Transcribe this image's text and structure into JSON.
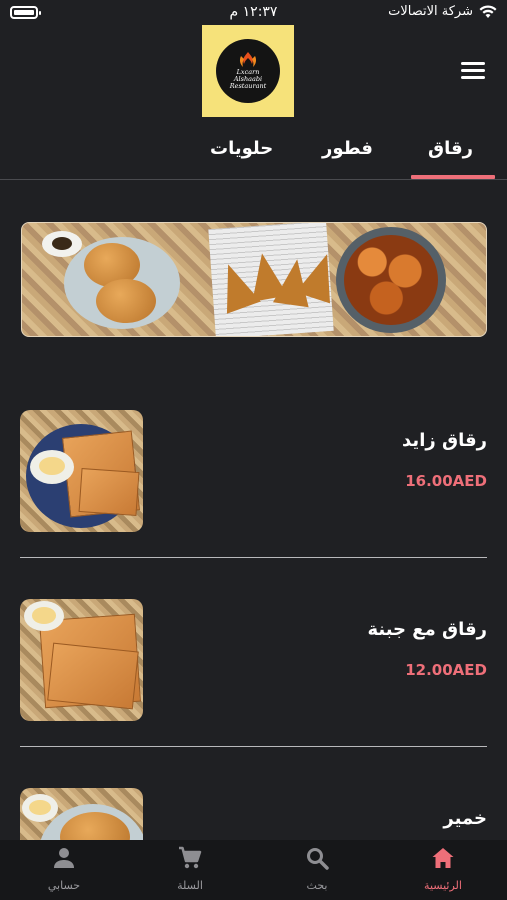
{
  "status_bar": {
    "time": "١٢:٣٧ م",
    "carrier": "شركة الاتصالات"
  },
  "header": {
    "logo_text": [
      "Lxcarn",
      "Alshaabi",
      "Restaurant"
    ]
  },
  "tabs": [
    {
      "label": "رقاق",
      "active": true
    },
    {
      "label": "فطور",
      "active": false
    },
    {
      "label": "حلويات",
      "active": false
    }
  ],
  "products": [
    {
      "name": "رقاق زايد",
      "price": "16.00AED"
    },
    {
      "name": "رقاق مع جبنة",
      "price": "12.00AED"
    },
    {
      "name": "خمير",
      "price": ""
    }
  ],
  "bottom_nav": [
    {
      "label": "الرئيسية",
      "icon": "home-icon",
      "active": true
    },
    {
      "label": "بحث",
      "icon": "search-icon",
      "active": false
    },
    {
      "label": "السلة",
      "icon": "cart-icon",
      "active": false
    },
    {
      "label": "حسابي",
      "icon": "account-icon",
      "active": false
    }
  ],
  "colors": {
    "background": "#1f2023",
    "accent": "#ee6f79",
    "logo_bg": "#f6e27a"
  }
}
